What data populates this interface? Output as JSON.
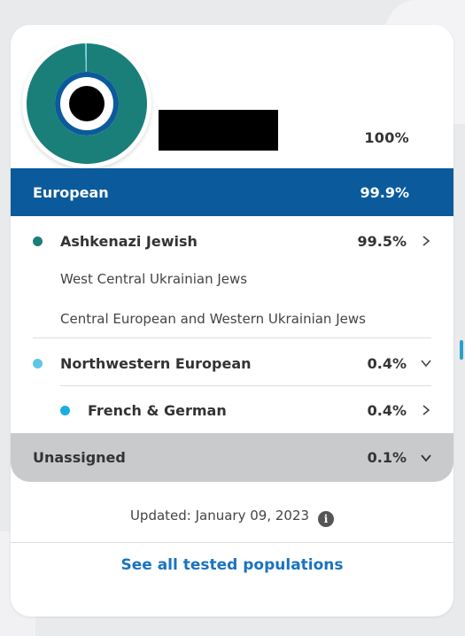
{
  "summary": {
    "total_percent": "100%",
    "redacted_name": ""
  },
  "region": {
    "label": "European",
    "percent": "99.9%",
    "color": "#0a5a9c"
  },
  "populations": [
    {
      "label": "Ashkenazi Jewish",
      "percent": "99.5%",
      "dot_color": "#1a7f78",
      "subregions": [
        "West Central Ukrainian Jews",
        "Central European and Western Ukrainian Jews"
      ]
    },
    {
      "label": "Northwestern European",
      "percent": "0.4%",
      "dot_color": "#5ec7e6",
      "children": [
        {
          "label": "French & German",
          "percent": "0.4%",
          "dot_color": "#19aee0"
        }
      ]
    }
  ],
  "unassigned": {
    "label": "Unassigned",
    "percent": "0.1%"
  },
  "footer": {
    "updated": "Updated: January 09, 2023",
    "info_icon": "info-icon",
    "see_all": "See all tested populations"
  },
  "chart_data": {
    "type": "pie",
    "categories": [
      "Ashkenazi Jewish",
      "Northwestern European",
      "Unassigned"
    ],
    "values": [
      99.5,
      0.4,
      0.1
    ],
    "colors": [
      "#1a7f78",
      "#5ec7e6",
      "#c9cacc"
    ]
  }
}
